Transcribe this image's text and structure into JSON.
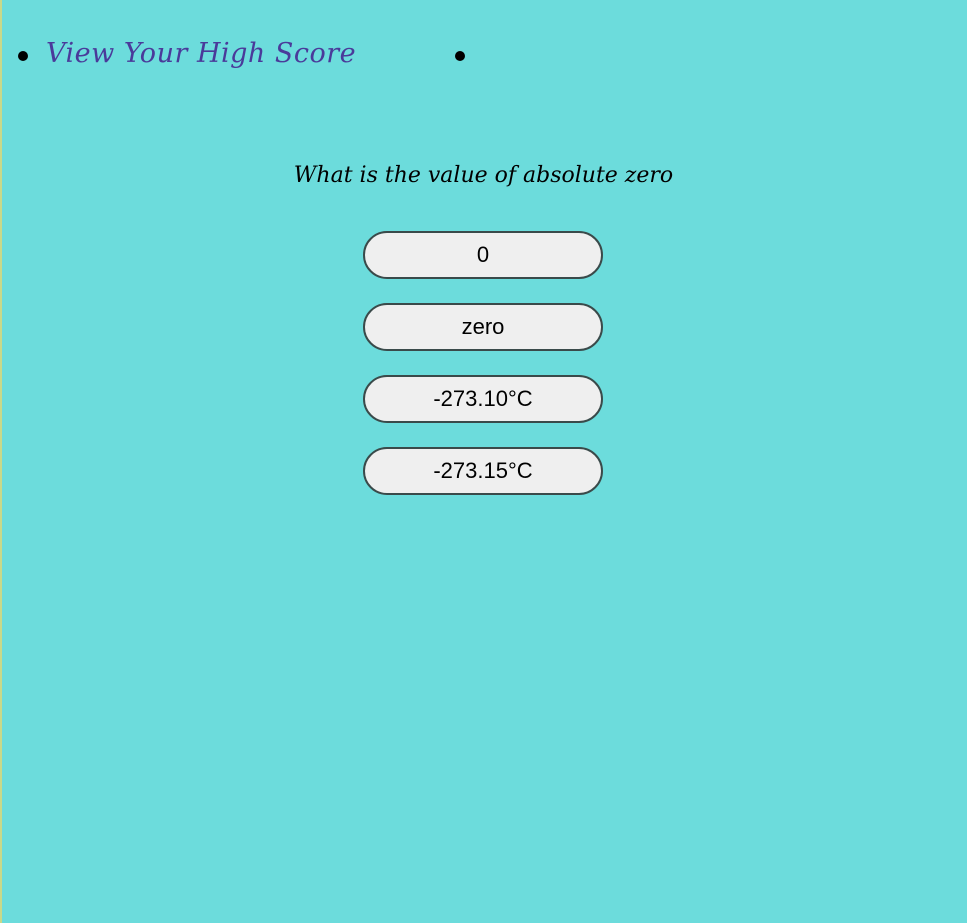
{
  "nav": {
    "high_score_link": "View Your High Score"
  },
  "quiz": {
    "question": "What is the value of absolute zero",
    "answers": [
      {
        "label": "0"
      },
      {
        "label": "zero"
      },
      {
        "label": "-273.10°C"
      },
      {
        "label": "-273.15°C"
      }
    ]
  },
  "colors": {
    "background": "#6cdcdc",
    "link": "#4a3a9a",
    "button_bg": "#efefef",
    "button_border": "#3a4a4a"
  }
}
